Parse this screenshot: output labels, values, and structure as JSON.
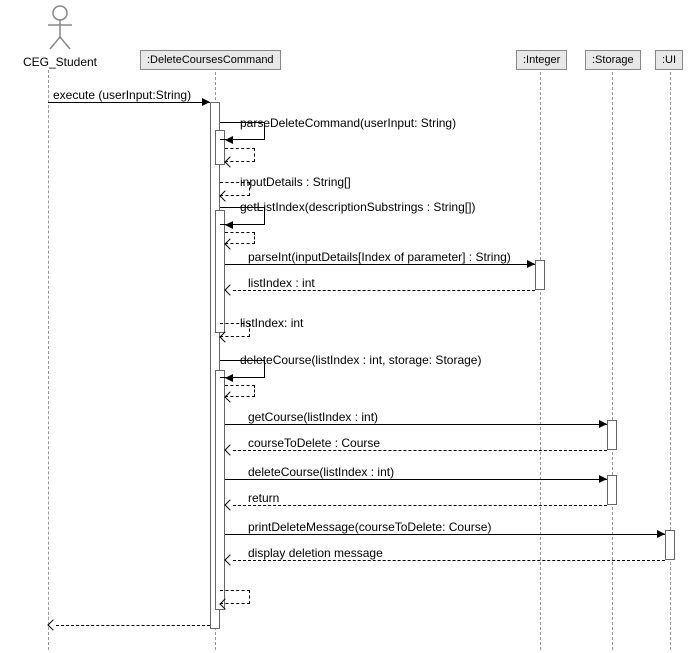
{
  "actor": {
    "name": "CEG_Student"
  },
  "lifelines": {
    "deleteCmd": ":DeleteCoursesCommand",
    "integer": ":Integer",
    "storage": ":Storage",
    "ui": ":UI"
  },
  "messages": {
    "execute": "execute (userInput:String)",
    "parseDelete": "parseDeleteCommand(userInput: String)",
    "inputDetails": "inputDetails : String[]",
    "getListIndex": "getListIndex(descriptionSubstrings : String[])",
    "parseInt": "parseInt(inputDetails[Index of parameter] : String)",
    "listIndexReturn": "listIndex : int",
    "listIndexReturn2": "listIndex: int",
    "deleteCourse": "deleteCourse(listIndex : int, storage: Storage)",
    "getCourse": "getCourse(listIndex : int)",
    "courseToDelete": "courseToDelete : Course",
    "deleteCourseStorage": "deleteCourse(listIndex : int)",
    "return": "return",
    "printDelete": "printDeleteMessage(courseToDelete: Course)",
    "displayMsg": "display deletion message"
  },
  "chart_data": {
    "type": "sequence-diagram",
    "actors": [
      "CEG_Student"
    ],
    "objects": [
      ":DeleteCoursesCommand",
      ":Integer",
      ":Storage",
      ":UI"
    ],
    "interactions": [
      {
        "from": "CEG_Student",
        "to": ":DeleteCoursesCommand",
        "label": "execute (userInput:String)",
        "type": "sync"
      },
      {
        "from": ":DeleteCoursesCommand",
        "to": ":DeleteCoursesCommand",
        "label": "parseDeleteCommand(userInput: String)",
        "type": "self"
      },
      {
        "from": ":DeleteCoursesCommand",
        "to": ":DeleteCoursesCommand",
        "label": "inputDetails : String[]",
        "type": "self-return"
      },
      {
        "from": ":DeleteCoursesCommand",
        "to": ":DeleteCoursesCommand",
        "label": "getListIndex(descriptionSubstrings : String[])",
        "type": "self"
      },
      {
        "from": ":DeleteCoursesCommand",
        "to": ":Integer",
        "label": "parseInt(inputDetails[Index of parameter] : String)",
        "type": "sync"
      },
      {
        "from": ":Integer",
        "to": ":DeleteCoursesCommand",
        "label": "listIndex : int",
        "type": "return"
      },
      {
        "from": ":DeleteCoursesCommand",
        "to": ":DeleteCoursesCommand",
        "label": "listIndex: int",
        "type": "self-return"
      },
      {
        "from": ":DeleteCoursesCommand",
        "to": ":DeleteCoursesCommand",
        "label": "deleteCourse(listIndex : int, storage: Storage)",
        "type": "self"
      },
      {
        "from": ":DeleteCoursesCommand",
        "to": ":Storage",
        "label": "getCourse(listIndex : int)",
        "type": "sync"
      },
      {
        "from": ":Storage",
        "to": ":DeleteCoursesCommand",
        "label": "courseToDelete : Course",
        "type": "return"
      },
      {
        "from": ":DeleteCoursesCommand",
        "to": ":Storage",
        "label": "deleteCourse(listIndex : int)",
        "type": "sync"
      },
      {
        "from": ":Storage",
        "to": ":DeleteCoursesCommand",
        "label": "return",
        "type": "return"
      },
      {
        "from": ":DeleteCoursesCommand",
        "to": ":UI",
        "label": "printDeleteMessage(courseToDelete: Course)",
        "type": "sync"
      },
      {
        "from": ":UI",
        "to": ":DeleteCoursesCommand",
        "label": "display deletion message",
        "type": "return"
      },
      {
        "from": ":DeleteCoursesCommand",
        "to": ":DeleteCoursesCommand",
        "label": "",
        "type": "self-return"
      },
      {
        "from": ":DeleteCoursesCommand",
        "to": "CEG_Student",
        "label": "",
        "type": "return"
      }
    ]
  }
}
